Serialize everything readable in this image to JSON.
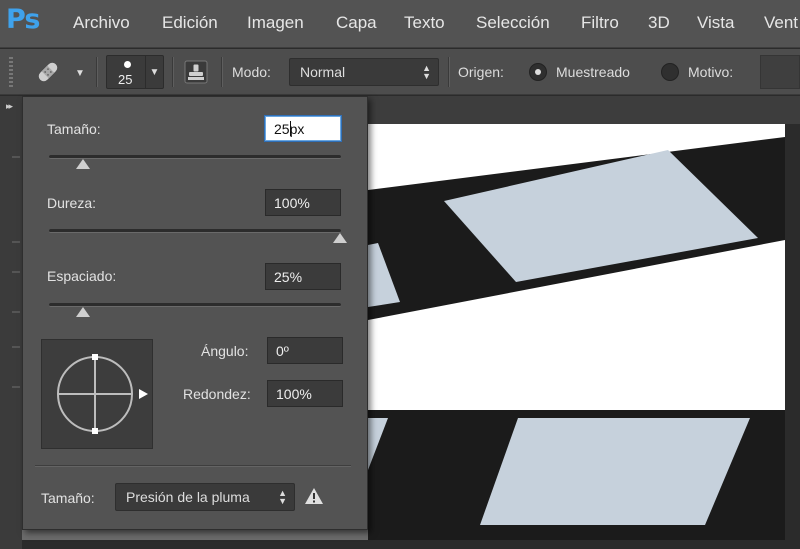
{
  "app": {
    "logo": "Ps"
  },
  "menu": {
    "items": [
      "Archivo",
      "Edición",
      "Imagen",
      "Capa",
      "Texto",
      "Selección",
      "Filtro",
      "3D",
      "Vista",
      "Vent"
    ]
  },
  "options_bar": {
    "tool_icon": "healing-brush-icon",
    "brush_size": "25",
    "stamp_icon": "clone-stamp-icon",
    "mode_label": "Modo:",
    "mode_value": "Normal",
    "source_label": "Origen:",
    "source_options": [
      {
        "label": "Muestreado",
        "selected": true
      },
      {
        "label": "Motivo",
        "selected": false
      }
    ],
    "motivo_label": "Motivo:"
  },
  "brush_panel": {
    "size": {
      "label": "Tamaño:",
      "value_typed": "25",
      "value_rest": "px",
      "slider": 0.12
    },
    "hardness": {
      "label": "Dureza:",
      "value": "100%",
      "slider": 1.0
    },
    "spacing": {
      "label": "Espaciado:",
      "value": "25%",
      "slider": 0.11
    },
    "angle": {
      "label": "Ángulo:",
      "value": "0º"
    },
    "roundness": {
      "label": "Redondez:",
      "value": "100%"
    },
    "size_control": {
      "label": "Tamaño:",
      "value": "Presión de la pluma",
      "warning_icon": "warning-icon"
    }
  },
  "colors": {
    "menubar": "#535353",
    "panel": "#535353",
    "accent": "#3fa2ec",
    "clapper_white": "#c6d1dc",
    "clapper_black": "#1b1b1b"
  }
}
